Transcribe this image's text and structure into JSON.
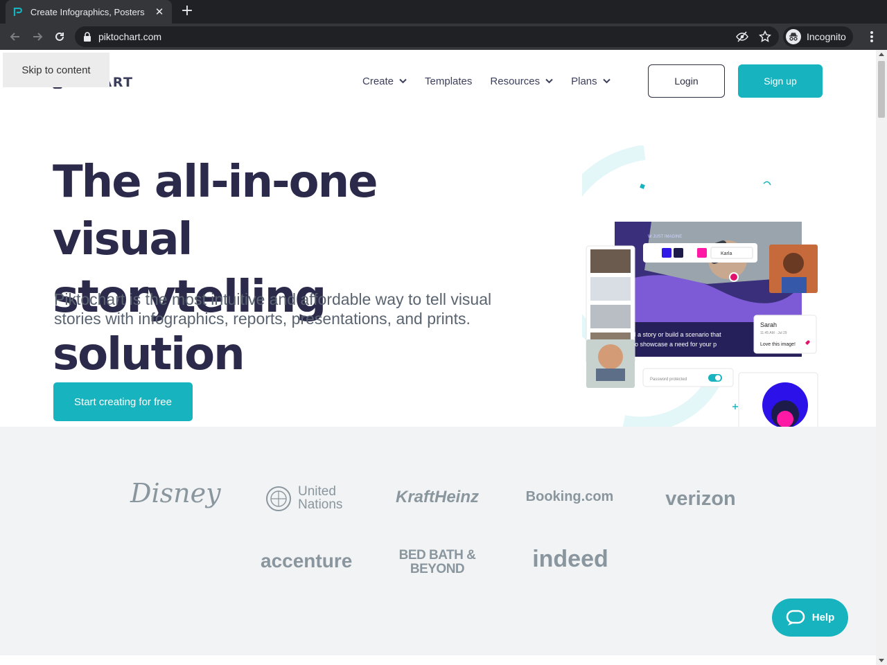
{
  "browser": {
    "tab_title": "Create Infographics, Posters",
    "url": "piktochart.com",
    "incognito_label": "Incognito"
  },
  "page": {
    "skip_link": "Skip to content",
    "logo_text": "OCHART",
    "nav": [
      {
        "label": "Create",
        "has_dropdown": true
      },
      {
        "label": "Templates",
        "has_dropdown": false
      },
      {
        "label": "Resources",
        "has_dropdown": true
      },
      {
        "label": "Plans",
        "has_dropdown": true
      }
    ],
    "login_label": "Login",
    "signup_label": "Sign up",
    "hero": {
      "title_line1": "The all-in-one visual",
      "title_line2": "storytelling solution",
      "subtitle": "Piktochart is the most intuitive and affordable way to tell visual stories with infographics, reports, presentations, and prints.",
      "cta_label": "Start creating for free",
      "art": {
        "font_select": "Karla",
        "comment_name": "Sarah",
        "comment_time": "11:45 AM · Jul 29",
        "comment_text": "Love this image!",
        "caption": "Tell a story or build a scenario that",
        "caption2": "le to showcase a need for your p",
        "heading_snip": "W JUST IMAGINE",
        "password_label": "Password protected"
      }
    },
    "logos": [
      "Disney",
      "United Nations",
      "KraftHeinz",
      "Booking.com",
      "verizon",
      "accenture",
      "BED BATH & BEYOND",
      "indeed"
    ],
    "help_label": "Help"
  },
  "colors": {
    "brand_teal": "#17b3bf",
    "heading": "#2c2a4a",
    "logo_gray": "#8a969e"
  }
}
